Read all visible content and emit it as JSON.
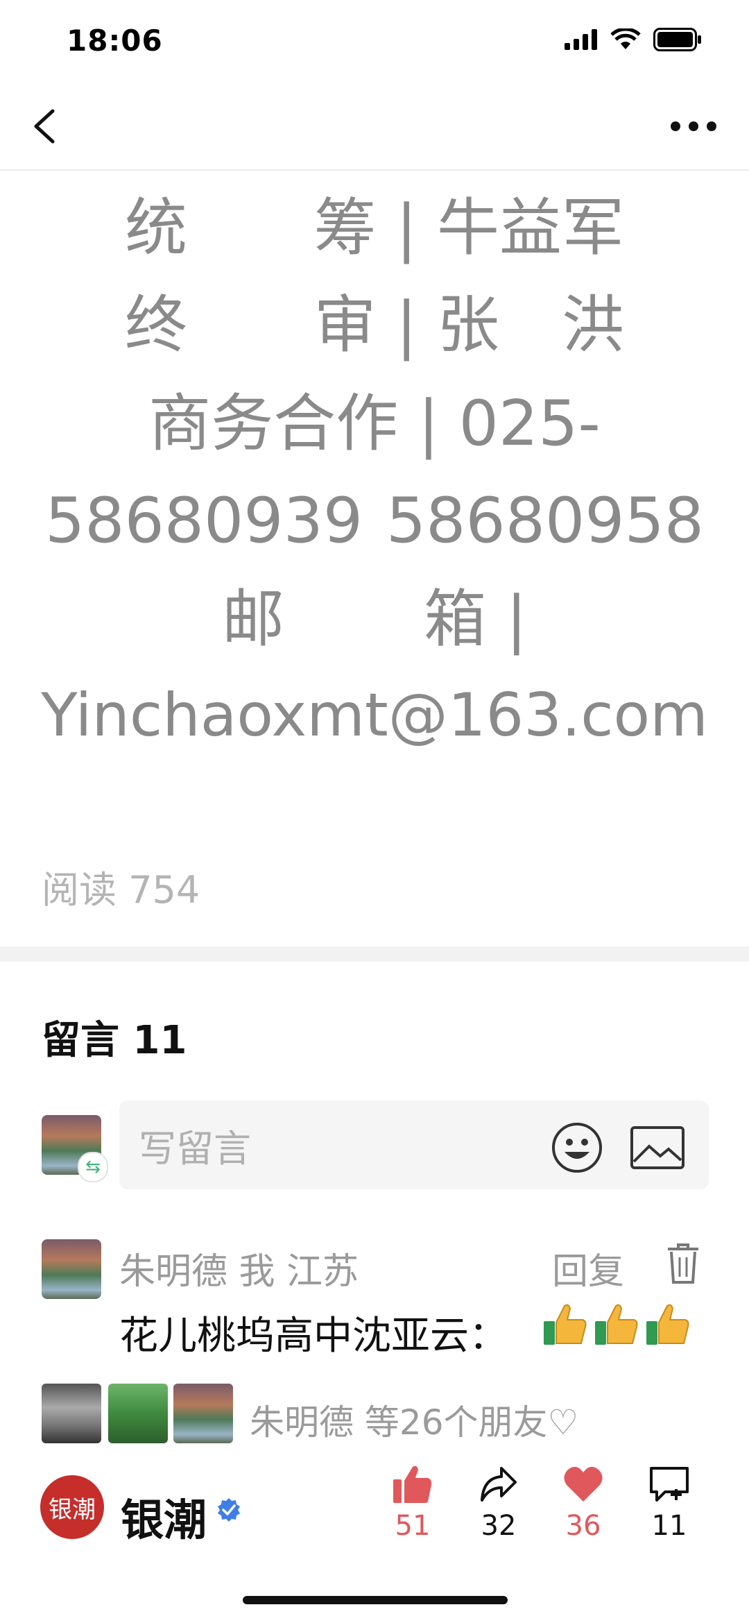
{
  "status_bar": {
    "time": "18:06"
  },
  "article": {
    "credits": {
      "line1": {
        "left": "统",
        "right": "筹 | 牛益军"
      },
      "line2": {
        "left": "终",
        "right": "审 | 张　洪"
      },
      "line3": "商务合作 | 025-",
      "line4": {
        "left": "58680939",
        "right": "58680958"
      },
      "line5": {
        "left": "邮",
        "right": "箱 |"
      },
      "line6": "Yinchaoxmt@163.com"
    },
    "read_label": "阅读",
    "read_count": "754"
  },
  "comments": {
    "title_label": "留言",
    "title_count": "11",
    "input_placeholder": "写留言",
    "items": [
      {
        "author": "朱明德 我 江苏",
        "reply_label": "回复",
        "text": "花儿桃坞高中沈亚云："
      }
    ],
    "likers_text": "朱明德 等26个朋友♡"
  },
  "toolbar": {
    "brand_logo_text": "银潮",
    "brand_name": "银潮",
    "like_count": "51",
    "share_count": "32",
    "love_count": "36",
    "comment_count": "11"
  },
  "colors": {
    "accent_red": "#e0585b",
    "verified_blue": "#3f7ee8",
    "brand_red": "#c52e2a"
  },
  "icons": [
    "back-icon",
    "more-icon",
    "signal-icon",
    "wifi-icon",
    "battery-icon",
    "emoji-icon",
    "image-icon",
    "trash-icon",
    "thumbs-up-icon",
    "share-icon",
    "heart-icon",
    "comment-icon",
    "verified-icon"
  ]
}
